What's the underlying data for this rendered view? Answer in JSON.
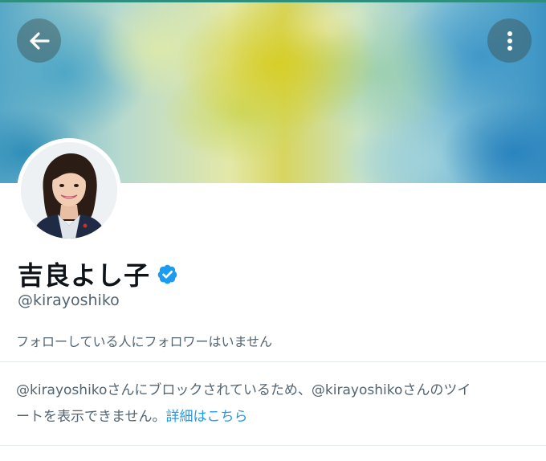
{
  "profile": {
    "display_name": "吉良よし子",
    "handle": "@kirayoshiko",
    "verified": true,
    "follow_note": "フォローしている人にフォロワーはいません"
  },
  "block_notice": {
    "line1": "@kirayoshikoさんにブロックされているため、@kirayoshikoさんのツイ",
    "line2": "ートを表示できません。",
    "link": "詳細はこちら"
  },
  "icons": {
    "back": "arrow-left-icon",
    "more": "more-vertical-icon",
    "verified": "verified-badge-icon"
  },
  "colors": {
    "accent": "#1d9bf0",
    "secondary_text": "#536471",
    "verified": "#1d9bf0"
  }
}
